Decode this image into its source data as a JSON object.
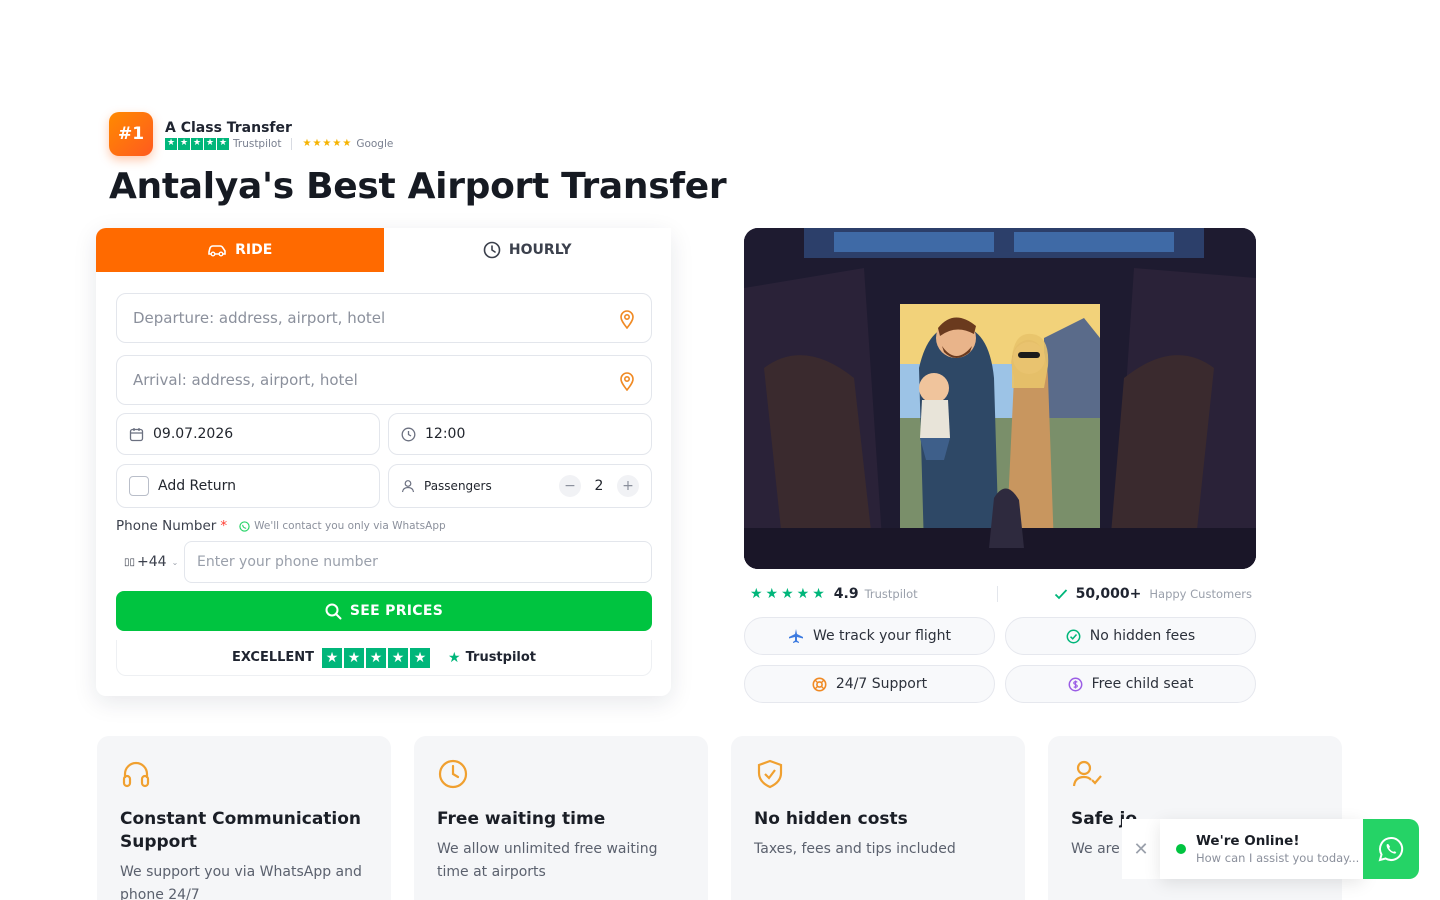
{
  "brand": {
    "badge": "#1",
    "name": "A Class Transfer",
    "trustpilot_label": "Trustpilot",
    "google_label": "Google"
  },
  "page_title": "Antalya's Best Airport Transfer",
  "tabs": [
    {
      "label": "RIDE",
      "active": true
    },
    {
      "label": "HOURLY",
      "active": false
    }
  ],
  "form": {
    "departure_placeholder": "Departure: address, airport, hotel",
    "arrival_placeholder": "Arrival: address, airport, hotel",
    "date": "09.07.2026",
    "time": "12:00",
    "add_return_label": "Add Return",
    "passengers_label": "Passengers",
    "passengers_count": "2",
    "phone_label": "Phone Number",
    "phone_required": "*",
    "whatsapp_note": "We'll contact you only via WhatsApp",
    "country_code": "+44",
    "country_flag": "▯▯",
    "phone_placeholder": "Enter your phone number",
    "submit_label": "SEE PRICES",
    "rating_word": "EXCELLENT",
    "trustpilot_label": "Trustpilot"
  },
  "stats": {
    "rating": "4.9",
    "rating_source": "Trustpilot",
    "customers": "50,000+",
    "customers_label": "Happy Customers"
  },
  "badges": [
    {
      "label": "We track your flight",
      "icon": "plane-icon"
    },
    {
      "label": "No hidden fees",
      "icon": "check-circle-icon"
    },
    {
      "label": "24/7 Support",
      "icon": "lifebuoy-icon"
    },
    {
      "label": "Free child seat",
      "icon": "coin-icon"
    }
  ],
  "features": [
    {
      "title": "Constant Communication Support",
      "text": "We support you via WhatsApp and phone 24/7",
      "icon": "headphones-icon"
    },
    {
      "title": "Free waiting time",
      "text": "We allow unlimited free waiting time at airports",
      "icon": "clock-icon"
    },
    {
      "title": "No hidden costs",
      "text": "Taxes, fees and tips included",
      "icon": "shield-check-icon"
    },
    {
      "title": "Safe jo",
      "text": "We are know ou",
      "icon": "user-check-icon"
    }
  ],
  "chat": {
    "title": "We're Online!",
    "subtitle": "How can I assist you today...",
    "close": "✕"
  },
  "colors": {
    "accent": "#ff6a00",
    "cta": "#00c440",
    "trustpilot": "#00b67a",
    "whatsapp": "#25d366"
  }
}
